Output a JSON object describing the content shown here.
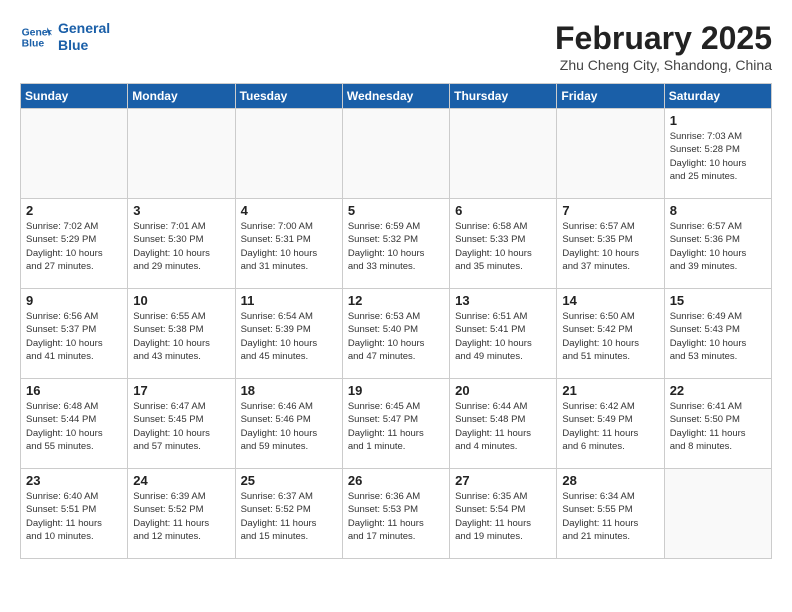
{
  "header": {
    "logo_line1": "General",
    "logo_line2": "Blue",
    "month_title": "February 2025",
    "subtitle": "Zhu Cheng City, Shandong, China"
  },
  "weekdays": [
    "Sunday",
    "Monday",
    "Tuesday",
    "Wednesday",
    "Thursday",
    "Friday",
    "Saturday"
  ],
  "weeks": [
    [
      {
        "day": "",
        "info": ""
      },
      {
        "day": "",
        "info": ""
      },
      {
        "day": "",
        "info": ""
      },
      {
        "day": "",
        "info": ""
      },
      {
        "day": "",
        "info": ""
      },
      {
        "day": "",
        "info": ""
      },
      {
        "day": "1",
        "info": "Sunrise: 7:03 AM\nSunset: 5:28 PM\nDaylight: 10 hours\nand 25 minutes."
      }
    ],
    [
      {
        "day": "2",
        "info": "Sunrise: 7:02 AM\nSunset: 5:29 PM\nDaylight: 10 hours\nand 27 minutes."
      },
      {
        "day": "3",
        "info": "Sunrise: 7:01 AM\nSunset: 5:30 PM\nDaylight: 10 hours\nand 29 minutes."
      },
      {
        "day": "4",
        "info": "Sunrise: 7:00 AM\nSunset: 5:31 PM\nDaylight: 10 hours\nand 31 minutes."
      },
      {
        "day": "5",
        "info": "Sunrise: 6:59 AM\nSunset: 5:32 PM\nDaylight: 10 hours\nand 33 minutes."
      },
      {
        "day": "6",
        "info": "Sunrise: 6:58 AM\nSunset: 5:33 PM\nDaylight: 10 hours\nand 35 minutes."
      },
      {
        "day": "7",
        "info": "Sunrise: 6:57 AM\nSunset: 5:35 PM\nDaylight: 10 hours\nand 37 minutes."
      },
      {
        "day": "8",
        "info": "Sunrise: 6:57 AM\nSunset: 5:36 PM\nDaylight: 10 hours\nand 39 minutes."
      }
    ],
    [
      {
        "day": "9",
        "info": "Sunrise: 6:56 AM\nSunset: 5:37 PM\nDaylight: 10 hours\nand 41 minutes."
      },
      {
        "day": "10",
        "info": "Sunrise: 6:55 AM\nSunset: 5:38 PM\nDaylight: 10 hours\nand 43 minutes."
      },
      {
        "day": "11",
        "info": "Sunrise: 6:54 AM\nSunset: 5:39 PM\nDaylight: 10 hours\nand 45 minutes."
      },
      {
        "day": "12",
        "info": "Sunrise: 6:53 AM\nSunset: 5:40 PM\nDaylight: 10 hours\nand 47 minutes."
      },
      {
        "day": "13",
        "info": "Sunrise: 6:51 AM\nSunset: 5:41 PM\nDaylight: 10 hours\nand 49 minutes."
      },
      {
        "day": "14",
        "info": "Sunrise: 6:50 AM\nSunset: 5:42 PM\nDaylight: 10 hours\nand 51 minutes."
      },
      {
        "day": "15",
        "info": "Sunrise: 6:49 AM\nSunset: 5:43 PM\nDaylight: 10 hours\nand 53 minutes."
      }
    ],
    [
      {
        "day": "16",
        "info": "Sunrise: 6:48 AM\nSunset: 5:44 PM\nDaylight: 10 hours\nand 55 minutes."
      },
      {
        "day": "17",
        "info": "Sunrise: 6:47 AM\nSunset: 5:45 PM\nDaylight: 10 hours\nand 57 minutes."
      },
      {
        "day": "18",
        "info": "Sunrise: 6:46 AM\nSunset: 5:46 PM\nDaylight: 10 hours\nand 59 minutes."
      },
      {
        "day": "19",
        "info": "Sunrise: 6:45 AM\nSunset: 5:47 PM\nDaylight: 11 hours\nand 1 minute."
      },
      {
        "day": "20",
        "info": "Sunrise: 6:44 AM\nSunset: 5:48 PM\nDaylight: 11 hours\nand 4 minutes."
      },
      {
        "day": "21",
        "info": "Sunrise: 6:42 AM\nSunset: 5:49 PM\nDaylight: 11 hours\nand 6 minutes."
      },
      {
        "day": "22",
        "info": "Sunrise: 6:41 AM\nSunset: 5:50 PM\nDaylight: 11 hours\nand 8 minutes."
      }
    ],
    [
      {
        "day": "23",
        "info": "Sunrise: 6:40 AM\nSunset: 5:51 PM\nDaylight: 11 hours\nand 10 minutes."
      },
      {
        "day": "24",
        "info": "Sunrise: 6:39 AM\nSunset: 5:52 PM\nDaylight: 11 hours\nand 12 minutes."
      },
      {
        "day": "25",
        "info": "Sunrise: 6:37 AM\nSunset: 5:52 PM\nDaylight: 11 hours\nand 15 minutes."
      },
      {
        "day": "26",
        "info": "Sunrise: 6:36 AM\nSunset: 5:53 PM\nDaylight: 11 hours\nand 17 minutes."
      },
      {
        "day": "27",
        "info": "Sunrise: 6:35 AM\nSunset: 5:54 PM\nDaylight: 11 hours\nand 19 minutes."
      },
      {
        "day": "28",
        "info": "Sunrise: 6:34 AM\nSunset: 5:55 PM\nDaylight: 11 hours\nand 21 minutes."
      },
      {
        "day": "",
        "info": ""
      }
    ]
  ]
}
